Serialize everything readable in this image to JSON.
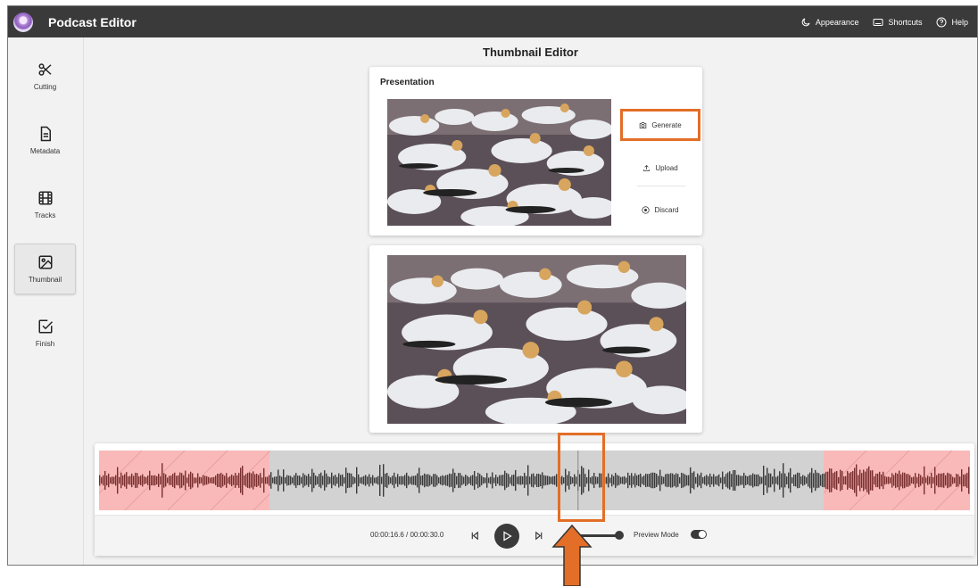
{
  "app": {
    "title": "Podcast Editor"
  },
  "topbar": {
    "appearance": "Appearance",
    "shortcuts": "Shortcuts",
    "help": "Help"
  },
  "sidebar": {
    "items": [
      {
        "label": "Cutting",
        "icon": "scissors-icon"
      },
      {
        "label": "Metadata",
        "icon": "document-icon"
      },
      {
        "label": "Tracks",
        "icon": "film-icon"
      },
      {
        "label": "Thumbnail",
        "icon": "image-icon",
        "active": true
      },
      {
        "label": "Finish",
        "icon": "checkbox-icon"
      }
    ]
  },
  "page": {
    "title": "Thumbnail Editor"
  },
  "presentation": {
    "label": "Presentation",
    "actions": {
      "generate": "Generate",
      "upload": "Upload",
      "discard": "Discard"
    }
  },
  "player": {
    "time": "00:00:16.6 / 00:00:30.0",
    "preview_mode_label": "Preview Mode",
    "preview_mode_on": true,
    "playhead_fraction": 0.55,
    "cut_start_fraction": 0.196,
    "cut_end_fraction": 0.832
  },
  "colors": {
    "topbar": "#3a3a3a",
    "highlight": "#e36e27",
    "cut_region": "#f9b9b9",
    "waveform": "#3a3a3a"
  }
}
